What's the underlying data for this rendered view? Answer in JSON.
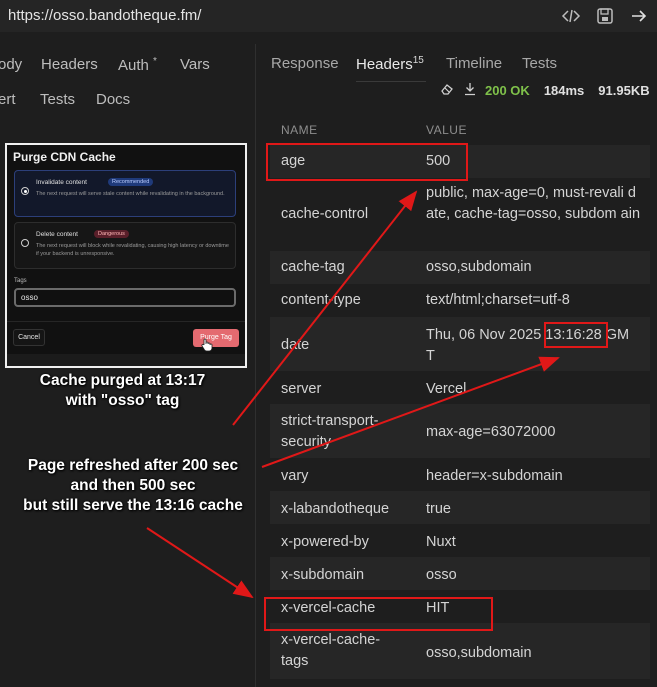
{
  "url": "https://osso.bandotheque.fm/",
  "url_icons": [
    "code-icon",
    "save-icon",
    "arrow-right-icon"
  ],
  "request_tabs": {
    "row1": [
      {
        "label": "ody"
      },
      {
        "label": "Headers"
      },
      {
        "label": "Auth",
        "sup": "*"
      },
      {
        "label": "Vars"
      }
    ],
    "row2": [
      {
        "label": "ert"
      },
      {
        "label": "Tests"
      },
      {
        "label": "Docs"
      }
    ]
  },
  "response_tabs": [
    {
      "label": "Response"
    },
    {
      "label": "Headers",
      "sup": "15",
      "active": true
    },
    {
      "label": "Timeline"
    },
    {
      "label": "Tests"
    }
  ],
  "status": {
    "code": "200 OK",
    "time": "184ms",
    "size": "91.95KB",
    "ok_color": "#7fc14a"
  },
  "columns": {
    "name": "NAME",
    "value": "VALUE"
  },
  "headers": [
    {
      "name": "age",
      "value": "500"
    },
    {
      "name": "cache-control",
      "value": "public, max-age=0, must-revali date, cache-tag=osso, subdom ain"
    },
    {
      "name": "cache-tag",
      "value": "osso,subdomain"
    },
    {
      "name": "content-type",
      "value": "text/html;charset=utf-8"
    },
    {
      "name": "date",
      "value": "Thu, 06 Nov 2025 13:16:28 GM T"
    },
    {
      "name": "server",
      "value": "Vercel"
    },
    {
      "name": "strict-transport-security",
      "value": "max-age=63072000"
    },
    {
      "name": "vary",
      "value": "header=x-subdomain"
    },
    {
      "name": "x-labandotheque",
      "value": "true"
    },
    {
      "name": "x-powered-by",
      "value": "Nuxt"
    },
    {
      "name": "x-subdomain",
      "value": "osso"
    },
    {
      "name": "x-vercel-cache",
      "value": "HIT"
    },
    {
      "name": "x-vercel-cache-tags",
      "value": "osso,subdomain"
    }
  ],
  "purge_dialog": {
    "title": "Purge CDN Cache",
    "option1": {
      "title": "Invalidate content",
      "badge": "Recommended",
      "desc": "The next request will serve stale content while revalidating in the background."
    },
    "option2": {
      "title": "Delete content",
      "badge": "Dangerous",
      "desc": "The next request will block while revalidating, causing high latency or downtime if your backend is unresponsive."
    },
    "tags_label": "Tags",
    "tags_value": "osso",
    "cancel": "Cancel",
    "purge": "Purge Tag"
  },
  "annotations": {
    "caption_top": [
      "Cache purged at 13:17",
      "with \"osso\" tag"
    ],
    "caption_mid": [
      "Page refreshed after 200 sec",
      "and then 500 sec",
      "but still serve the 13:16 cache"
    ],
    "highlight_color": "#e01818"
  }
}
